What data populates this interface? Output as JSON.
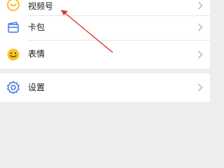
{
  "menu": {
    "group1": [
      {
        "key": "channels",
        "label": "视频号",
        "icon": "channels-icon"
      },
      {
        "key": "cards",
        "label": "卡包",
        "icon": "card-wallet-icon"
      },
      {
        "key": "stickers",
        "label": "表情",
        "icon": "sticker-smile-icon"
      }
    ],
    "group2": [
      {
        "key": "settings",
        "label": "设置",
        "icon": "settings-gear-icon"
      }
    ]
  },
  "colors": {
    "background": "#ededed",
    "row_bg": "#ffffff",
    "text": "#1a1a1a",
    "chevron": "#b2b2b2",
    "card_icon": "#3d7be8",
    "sticker_icon": "#f5b400",
    "settings_icon": "#2f6fd6",
    "annotation": "#e33333"
  }
}
